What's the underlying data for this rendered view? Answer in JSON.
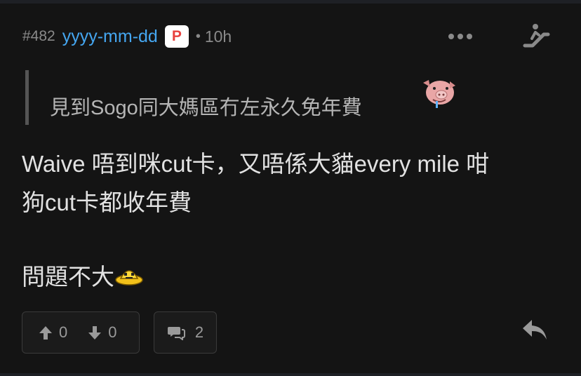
{
  "post": {
    "number": "#482",
    "username": "yyyy-mm-dd",
    "badge": "P",
    "dot": "•",
    "time": "10h"
  },
  "quote": {
    "text": "見到Sogo同大媽區冇左永久免年費",
    "emoji_icon": "drooling-pig-icon"
  },
  "content": {
    "line1": "Waive 唔到咪cut卡，又唔係大貓every mile 咁",
    "line2": "狗cut卡都收年費",
    "line3": "問題不大",
    "emoji_icon": "yellow-ufo-icon"
  },
  "actions": {
    "upvotes": "0",
    "downvotes": "0",
    "comments": "2"
  },
  "colors": {
    "background": "#141414",
    "username": "#45a6f0",
    "badge_letter": "#e8423f",
    "muted": "#8a8a8a"
  }
}
